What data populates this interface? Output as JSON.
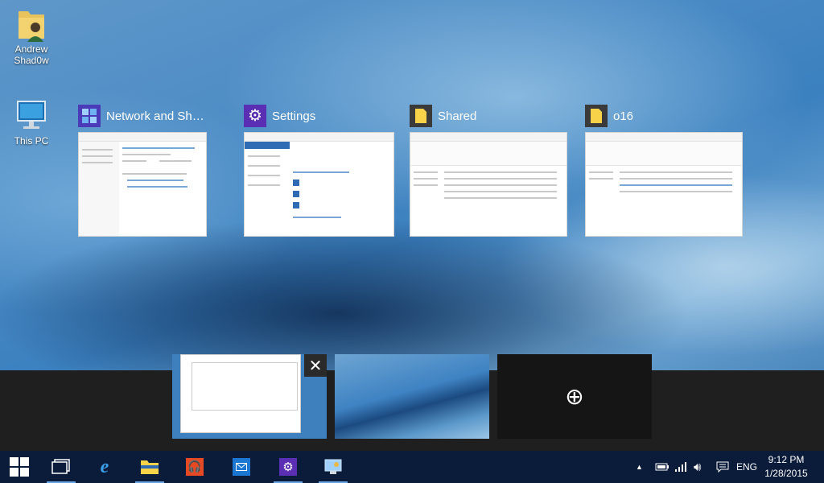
{
  "desktop_icons": [
    {
      "label_line1": "Andrew",
      "label_line2": "Shad0w"
    },
    {
      "label_line1": "This PC",
      "label_line2": ""
    }
  ],
  "task_view": {
    "windows": [
      {
        "title": "Network and Sh…",
        "app": "control-panel"
      },
      {
        "title": "Settings",
        "app": "settings"
      },
      {
        "title": "Shared",
        "app": "file-explorer"
      },
      {
        "title": "o16",
        "app": "file-explorer"
      }
    ],
    "close_glyph": "✕",
    "new_desktop_glyph": "⊕"
  },
  "taskbar": {
    "language": "ENG",
    "time": "9:12 PM",
    "date": "1/28/2015",
    "colors": {
      "background": "#0b1b3a",
      "active_indicator": "#6aa6e6"
    }
  }
}
